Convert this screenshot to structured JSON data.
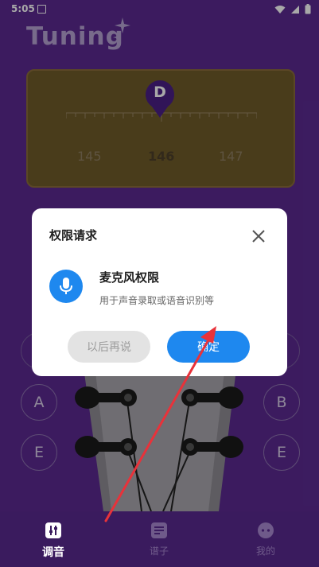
{
  "status": {
    "time": "5:05",
    "sim_label": "SIM"
  },
  "app": {
    "title": "Tuning"
  },
  "tuner": {
    "note": "D",
    "freq_left": "145",
    "freq_center": "146",
    "freq_right": "147"
  },
  "strings": {
    "left": [
      "A",
      "E"
    ],
    "right": [
      "B",
      "E"
    ]
  },
  "dialog": {
    "title": "权限请求",
    "permission_name": "麦克风权限",
    "permission_desc": "用于声音录取或语音识别等",
    "later_label": "以后再说",
    "ok_label": "确定"
  },
  "nav": {
    "items": [
      {
        "label": "调音",
        "icon": "tuning-sliders-icon",
        "active": true
      },
      {
        "label": "谱子",
        "icon": "sheet-music-icon",
        "active": false
      },
      {
        "label": "我的",
        "icon": "profile-chat-icon",
        "active": false
      }
    ]
  },
  "colors": {
    "background": "#5b2a91",
    "accent": "#1e88ef",
    "note_marker": "#4b1f86",
    "annotation_arrow": "#e8323a"
  }
}
